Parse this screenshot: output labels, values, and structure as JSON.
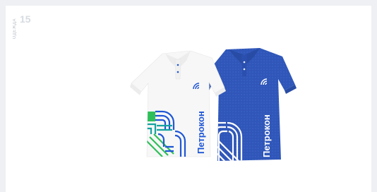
{
  "sidebar": {
    "label": "ОДЕЖДА"
  },
  "page": {
    "number": "15"
  },
  "brand": {
    "name": "Петрокон"
  },
  "colors": {
    "background": "#eef0f3",
    "card": "#ffffff",
    "shirt_white": "#f7f7f7",
    "shirt_blue": "#2f56b8",
    "accent_blue": "#1e56d6",
    "accent_teal": "#15a3a0",
    "accent_green": "#2fbf5a"
  },
  "icons": [
    "brand-logo-icon"
  ]
}
